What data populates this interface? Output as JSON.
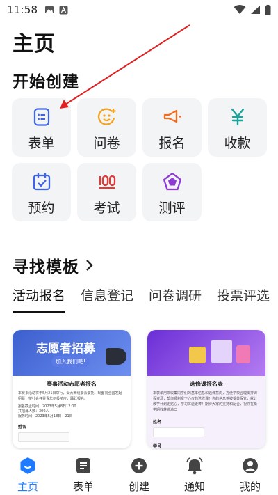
{
  "status_bar": {
    "time": "11:58"
  },
  "page_title": "主页",
  "create_section": {
    "title": "开始创建",
    "tiles": [
      {
        "label": "表单",
        "icon": "form-icon",
        "color": "#3d63e6"
      },
      {
        "label": "问卷",
        "icon": "smile-plus-icon",
        "color": "#f4a21b"
      },
      {
        "label": "报名",
        "icon": "megaphone-icon",
        "color": "#f26b1d"
      },
      {
        "label": "收款",
        "icon": "yen-icon",
        "color": "#1aa59a"
      },
      {
        "label": "预约",
        "icon": "calendar-check-icon",
        "color": "#3d63e6"
      },
      {
        "label": "考试",
        "icon": "score-100-icon",
        "color": "#e53935"
      },
      {
        "label": "测评",
        "icon": "pentagon-icon",
        "color": "#8e3bd6"
      }
    ]
  },
  "templates": {
    "title": "寻找模板",
    "tabs": [
      "活动报名",
      "信息登记",
      "问卷调研",
      "投票评选"
    ],
    "active_tab": 0,
    "cards": [
      {
        "banner_title": "志愿者招募",
        "banner_sub": "加入我们吧!",
        "heading": "赛事活动志愿者报名",
        "desc": "本赛事活动将于5月21日举行，受大赛组委会委托，现面向全国发起招募，望社会各界青年积极响应，踊跃报名。",
        "meta": [
          "报名截止时间：2023年5月8日12:00",
          "共招募人数：300人",
          "服务时间：2023年5月18日—21日"
        ],
        "field_label": "姓名"
      },
      {
        "heading": "选修课报名表",
        "desc": "本表单用来收集同学们的基本信息和选课意向，方便学校合理安排课程资源，帮你顺利拿下心仪的选修课！你的信息将被妥善保管，就让教学计划更贴心，学习体验更棒！期待大家的支持和配合，祝你在新学期收获满满😊",
        "field_label": "姓名",
        "field_label2": "学号"
      }
    ]
  },
  "bottom_nav": {
    "items": [
      {
        "label": "主页",
        "icon": "home-icon"
      },
      {
        "label": "表单",
        "icon": "list-doc-icon"
      },
      {
        "label": "创建",
        "icon": "plus-circle-icon"
      },
      {
        "label": "通知",
        "icon": "bell-icon"
      },
      {
        "label": "我的",
        "icon": "profile-icon"
      }
    ],
    "active_index": 0,
    "active_color": "#1e7bff"
  }
}
